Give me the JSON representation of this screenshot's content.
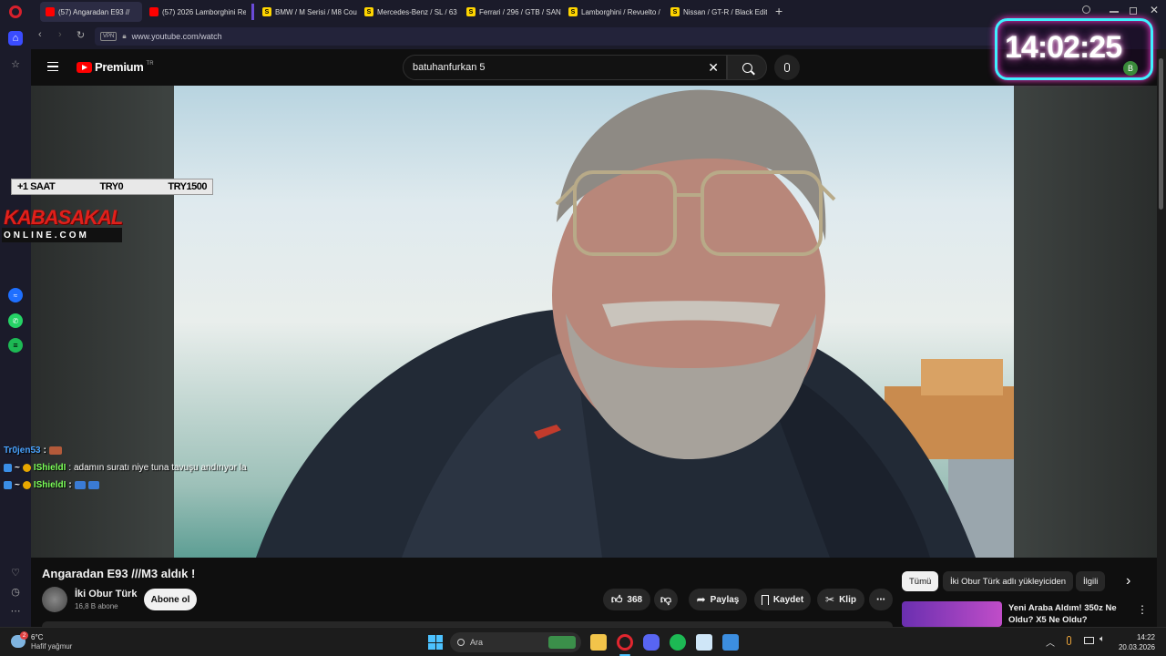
{
  "browser": {
    "tabs": [
      {
        "label": "(57) Angaradan E93 //",
        "icon": "youtube-icon"
      },
      {
        "label": "(57) 2026 Lamborghini Re",
        "icon": "youtube-icon"
      },
      {
        "label": "BMW / M Serisi / M8 Cou",
        "icon": "sahibinden-icon"
      },
      {
        "label": "Mercedes-Benz / SL / 63 /",
        "icon": "sahibinden-icon"
      },
      {
        "label": "Ferrari / 296 / GTB / SANT",
        "icon": "sahibinden-icon"
      },
      {
        "label": "Lamborghini / Revuelto /",
        "icon": "sahibinden-icon"
      },
      {
        "label": "Nissan / GT-R / Black Editi",
        "icon": "sahibinden-icon"
      }
    ],
    "url": "www.youtube.com/watch",
    "vpn_label": "VPN"
  },
  "youtube": {
    "logo_text": "Premium",
    "logo_region": "TR",
    "search_value": "batuhanfurkan 5"
  },
  "overlay": {
    "stream_bar": {
      "item1": "+1 SAAT",
      "item2": "TRY0",
      "item3": "TRY1500"
    },
    "brand_top": "KABASAKAL",
    "brand_bottom": "ONLINE.COM",
    "clock": "14:02:25",
    "clock_avatar": "B",
    "chat": [
      {
        "user": "Tr0jen53",
        "message": ":",
        "user_color": "#4aa3ff"
      },
      {
        "user": "IShieldI",
        "message": ": adamın suratı niye tuna tavuşu andırıyor la",
        "user_color": "#7cff5a"
      },
      {
        "user": "IShieldI",
        "message": ":",
        "user_color": "#7cff5a"
      }
    ]
  },
  "video": {
    "title": "Angaradan E93 ///M3 aldık !",
    "channel_name": "İki Obur Türk",
    "subscribers": "16,8 B abone",
    "subscribe_label": "Abone ol",
    "like_count": "368",
    "share_label": "Paylaş",
    "save_label": "Kaydet",
    "clip_label": "Klip"
  },
  "recommendations": {
    "chips": [
      "Tümü",
      "İki Obur Türk adlı yükleyiciden",
      "İlgili"
    ],
    "first_title": "Yeni Araba Aldım! 350z Ne Oldu? X5 Ne Oldu?"
  },
  "taskbar": {
    "weather_temp": "6°C",
    "weather_desc": "Hafif yağmur",
    "search_placeholder": "Ara",
    "time": "14:22",
    "date": "20.03.2026",
    "notification_count": "2"
  },
  "colors": {
    "yt_red": "#ff0000",
    "clock_border": "#3ff0ff",
    "clock_glow": "#ff3bd4",
    "brand_red": "#e0201b"
  }
}
